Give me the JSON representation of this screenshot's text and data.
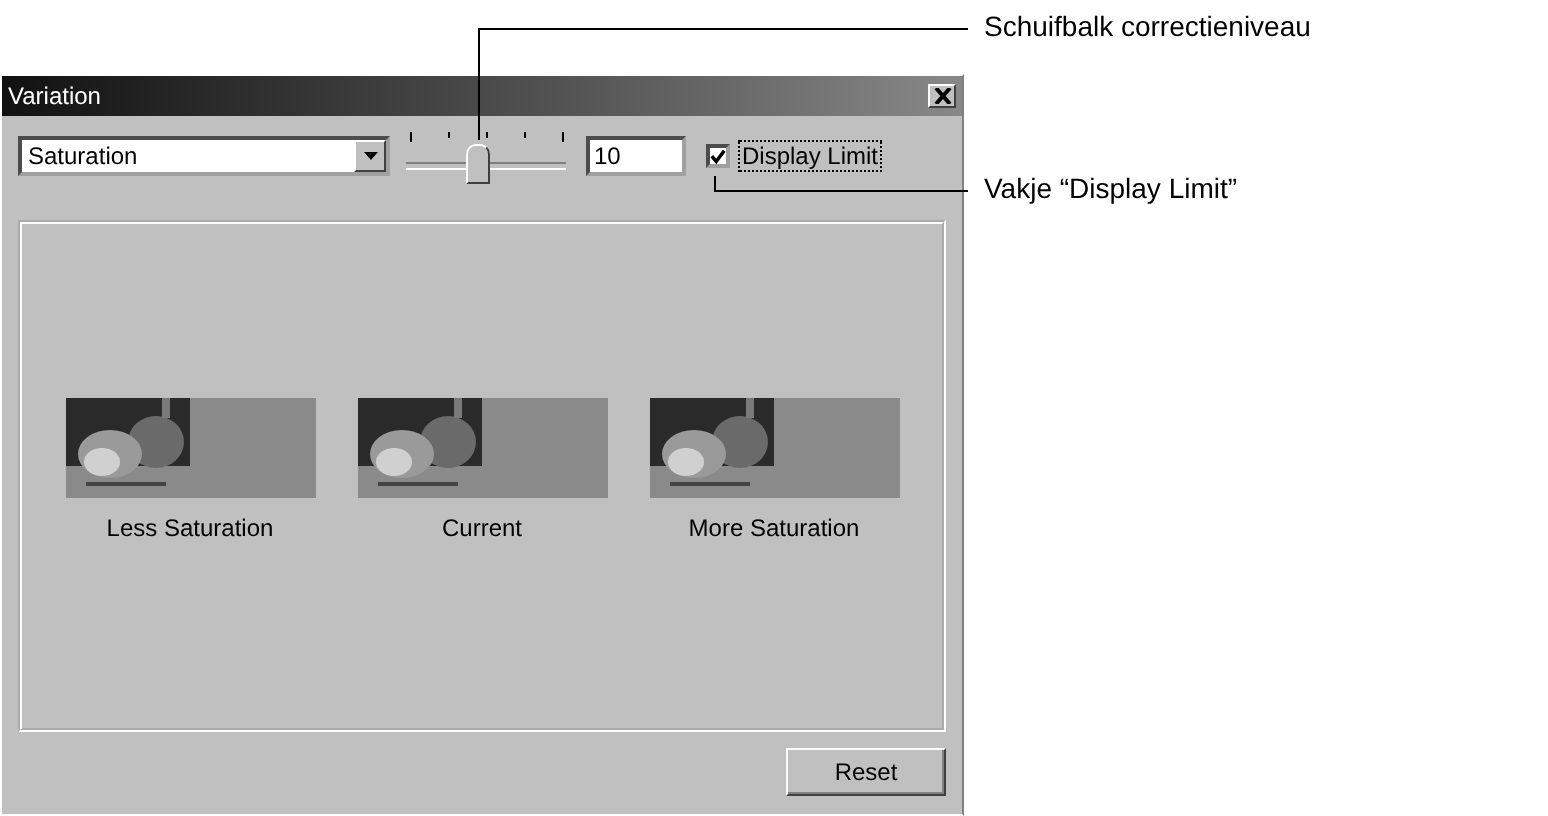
{
  "window": {
    "title": "Variation"
  },
  "controls": {
    "dropdown": {
      "value": "Saturation"
    },
    "slider": {
      "level": 0.45
    },
    "value_field": {
      "value": "10"
    },
    "display_limit": {
      "label": "Display Limit",
      "checked": true
    }
  },
  "variations": [
    {
      "label": "Less Saturation"
    },
    {
      "label": "Current"
    },
    {
      "label": "More Saturation"
    }
  ],
  "reset_button": "Reset",
  "callouts": [
    {
      "text": "Schuifbalk correctieniveau"
    },
    {
      "text": "Vakje “Display Limit”"
    }
  ]
}
